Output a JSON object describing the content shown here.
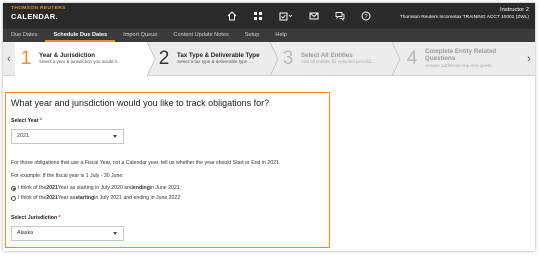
{
  "brand": {
    "line1": "THOMSON REUTERS",
    "line2": "CALENDAR."
  },
  "header": {
    "icons": [
      "home-icon",
      "grid-icon",
      "calendar-check-icon",
      "envelope-icon",
      "chat-icon",
      "help-icon"
    ],
    "user_name": "Instructor 2",
    "user_account": "Thomson Reuters Incometax TRAINING ACCT 10001 (ZWL)"
  },
  "nav": {
    "items": [
      "Due Dates",
      "Schedule Due Dates",
      "Import Queue",
      "Content Update Notes",
      "Setup",
      "Help"
    ],
    "active": "Schedule Due Dates"
  },
  "stepper": {
    "steps": [
      {
        "num": "1",
        "title": "Year & Jurisdiction",
        "desc": "Select a year & jurisdiction you would li..."
      },
      {
        "num": "2",
        "title": "Tax Type & Deliverable Type",
        "desc": "Select a tax type & deliverable type ..."
      },
      {
        "num": "3",
        "title": "Select All Entities",
        "desc": "Add all entities for selected jurisdict..."
      },
      {
        "num": "4",
        "title": "Complete Entity Related Questions",
        "desc": "Answer additional required questi..."
      }
    ]
  },
  "form": {
    "question": "What year and jurisdiction would you like to track obligations for?",
    "year_label": "Select Year",
    "year_value": "2021",
    "required_mark": "*",
    "fiscal_note": "For those obligations that use a Fiscal Year, not a Calendar year, tell us whether the year should Start or End in 2021.",
    "example_note": "For example: If the fiscal year is 1 July - 30 June:",
    "radio1": {
      "a": "I think of the ",
      "year": "2021",
      "b": " Year as starting in July 2020 and ",
      "end": "ending",
      "c": " in June 2021"
    },
    "radio2": {
      "a": "I think of the ",
      "year": "2021",
      "b": " Year as ",
      "start": "starting",
      "c": " in July 2021 and ending in June 2022"
    },
    "jurisdiction_label": "Select Jurisdiction",
    "jurisdiction_value": "Alaska"
  },
  "colors": {
    "accent": "#f08c2b",
    "header_bg": "#2a2a2a",
    "nav_bg": "#3b3b3b"
  }
}
